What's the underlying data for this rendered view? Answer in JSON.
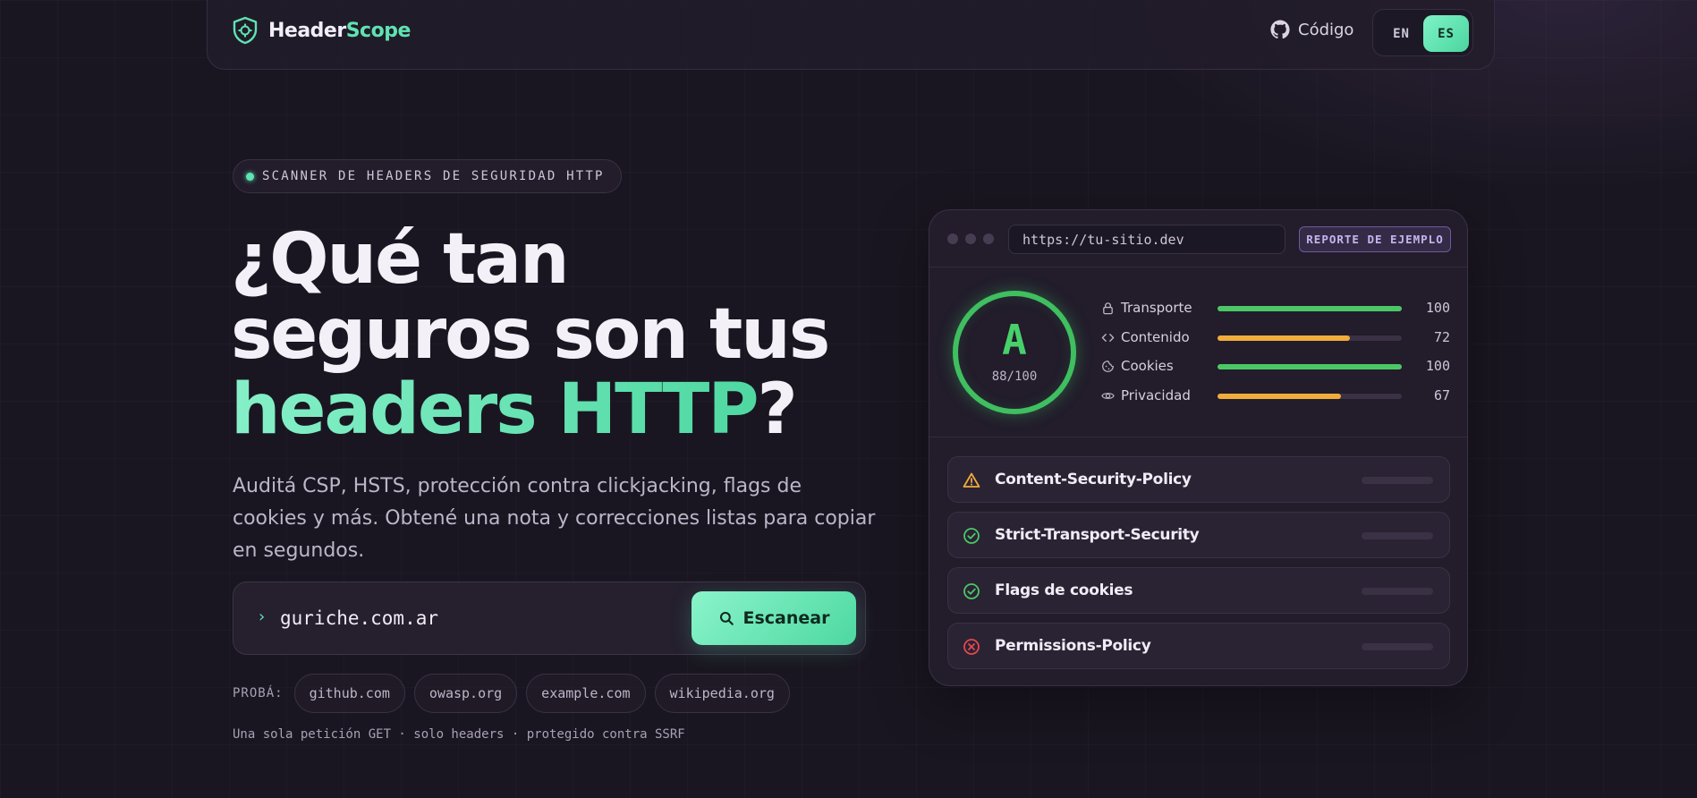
{
  "nav": {
    "logo_part1": "Header",
    "logo_part2": "Scope",
    "code_link": "Código",
    "lang_en": "EN",
    "lang_es": "ES",
    "active_lang": "ES"
  },
  "hero": {
    "pill": "SCANNER DE HEADERS DE SEGURIDAD HTTP",
    "headline_line1": "¿Qué tan",
    "headline_line2": "seguros son tus",
    "headline_highlight": "headers HTTP",
    "headline_end": "?",
    "subtitle": "Auditá CSP, HSTS, protección contra clickjacking, flags de cookies y más. Obtené una nota y correcciones listas para copiar en segundos.",
    "input_prompt": "›",
    "input_value": "guriche.com.ar",
    "scan_button": "Escanear",
    "try_label": "PROBÁ:",
    "try_chips": [
      "github.com",
      "owasp.org",
      "example.com",
      "wikipedia.org"
    ],
    "footnote": "Una sola petición GET · solo headers · protegido contra SSRF"
  },
  "report": {
    "url": "https://tu-sitio.dev",
    "badge": "REPORTE DE EJEMPLO",
    "grade": "A",
    "score": "88/100",
    "metrics": [
      {
        "label": "Transporte",
        "value": "100",
        "fraction": 1.0,
        "color": "#4cc766",
        "icon": "lock-icon"
      },
      {
        "label": "Contenido",
        "value": "72",
        "fraction": 0.72,
        "color": "#f0ad3c",
        "icon": "code-icon"
      },
      {
        "label": "Cookies",
        "value": "100",
        "fraction": 1.0,
        "color": "#4cc766",
        "icon": "cookie-icon"
      },
      {
        "label": "Privacidad",
        "value": "67",
        "fraction": 0.67,
        "color": "#f0ad3c",
        "icon": "eye-icon"
      }
    ],
    "headers": [
      {
        "label": "Content-Security-Policy",
        "status": "warning"
      },
      {
        "label": "Strict-Transport-Security",
        "status": "pass"
      },
      {
        "label": "Flags de cookies",
        "status": "pass"
      },
      {
        "label": "Permissions-Policy",
        "status": "fail"
      }
    ]
  },
  "colors": {
    "accent": "#5fe3b1",
    "pass": "#4cc766",
    "warning": "#f0ad3c",
    "fail": "#e5484d",
    "background": "#1a1621"
  }
}
